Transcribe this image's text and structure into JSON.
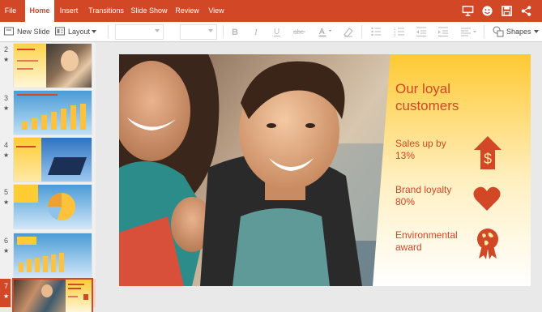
{
  "tabs": [
    {
      "label": "File",
      "active": false
    },
    {
      "label": "Home",
      "active": true
    },
    {
      "label": "Insert",
      "active": false
    },
    {
      "label": "Transitions",
      "active": false
    },
    {
      "label": "Slide Show",
      "active": false
    },
    {
      "label": "Review",
      "active": false
    },
    {
      "label": "View",
      "active": false
    }
  ],
  "titlebar_icons": [
    "present-icon",
    "smiley-feedback-icon",
    "save-icon",
    "share-icon"
  ],
  "ribbon": {
    "new_slide": "New Slide",
    "layout": "Layout",
    "font_name": "",
    "font_size": "",
    "shapes": "Shapes"
  },
  "thumbnails": [
    {
      "number": "2",
      "star": "★",
      "selected": false
    },
    {
      "number": "3",
      "star": "★",
      "selected": false
    },
    {
      "number": "4",
      "star": "★",
      "selected": false
    },
    {
      "number": "5",
      "star": "★",
      "selected": false
    },
    {
      "number": "6",
      "star": "★",
      "selected": false
    },
    {
      "number": "7",
      "star": "★",
      "selected": true
    }
  ],
  "slide": {
    "title": "Our loyal customers",
    "items": [
      {
        "text": "Sales up by 13%",
        "icon": "dollar-arrow-icon"
      },
      {
        "text": "Brand loyalty 80%",
        "icon": "heart-icon"
      },
      {
        "text": "Environmental award",
        "icon": "globe-award-icon"
      }
    ]
  },
  "colors": {
    "accent": "#d24726",
    "panel_top": "#ffcc33",
    "panel_bottom": "#ffffff"
  }
}
